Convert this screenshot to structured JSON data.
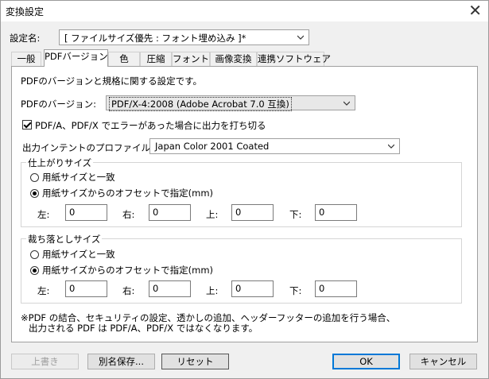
{
  "window": {
    "title": "変換設定",
    "close_glyph": "✕"
  },
  "setting": {
    "label": "設定名:",
    "value": "[ ファイルサイズ優先 : フォント埋め込み ]*"
  },
  "tabs": [
    {
      "label": "一般"
    },
    {
      "label": "PDFバージョン"
    },
    {
      "label": "色"
    },
    {
      "label": "圧縮"
    },
    {
      "label": "フォント"
    },
    {
      "label": "画像変換"
    },
    {
      "label": "連携ソフトウェア"
    }
  ],
  "panel": {
    "description": "PDFのバージョンと規格に関する設定です。",
    "version_label": "PDFのバージョン:",
    "version_value": "PDF/X-4:2008 (Adobe Acrobat 7.0 互換)",
    "error_checkbox_label": "PDF/A、PDF/X でエラーがあった場合に出力を打ち切る",
    "error_checkbox_checked": true,
    "intent_label": "出力インテントのプロファイル:",
    "intent_value": "Japan Color 2001 Coated",
    "finish_size": {
      "title": "仕上がりサイズ",
      "option1": "用紙サイズと一致",
      "option2": "用紙サイズからのオフセットで指定(mm)",
      "selected": "option2",
      "left_label": "左:",
      "left_value": "0",
      "right_label": "右:",
      "right_value": "0",
      "top_label": "上:",
      "top_value": "0",
      "bottom_label": "下:",
      "bottom_value": "0"
    },
    "bleed_size": {
      "title": "裁ち落としサイズ",
      "option1": "用紙サイズと一致",
      "option2": "用紙サイズからのオフセットで指定(mm)",
      "selected": "option2",
      "left_label": "左:",
      "left_value": "0",
      "right_label": "右:",
      "right_value": "0",
      "top_label": "上:",
      "top_value": "0",
      "bottom_label": "下:",
      "bottom_value": "0"
    },
    "note_line1": "※PDF の結合、セキュリティの設定、透かしの追加、ヘッダーフッターの追加を行う場合、",
    "note_line2": "出力される PDF は PDF/A、PDF/X ではなくなります。"
  },
  "buttons": {
    "overwrite": "上書き",
    "save_as": "別名保存...",
    "reset": "リセット",
    "ok": "OK",
    "cancel": "キャンセル"
  }
}
